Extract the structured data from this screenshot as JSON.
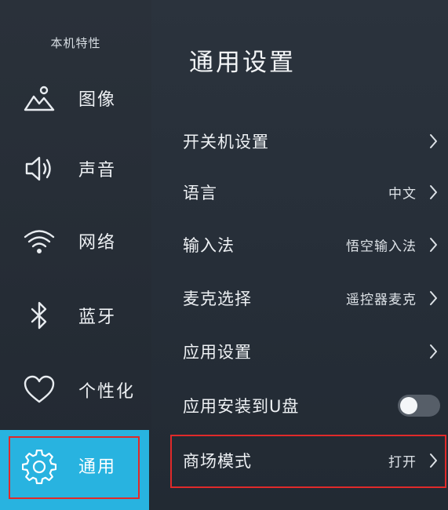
{
  "sidebar": {
    "title": "本机特性",
    "items": [
      {
        "label": "图像",
        "icon": "picture-icon"
      },
      {
        "label": "声音",
        "icon": "speaker-icon"
      },
      {
        "label": "网络",
        "icon": "wifi-icon"
      },
      {
        "label": "蓝牙",
        "icon": "bluetooth-icon"
      },
      {
        "label": "个性化",
        "icon": "heart-icon"
      },
      {
        "label": "通用",
        "icon": "gear-icon",
        "active": true
      }
    ]
  },
  "main": {
    "title": "通用设置",
    "rows": [
      {
        "label": "开关机设置",
        "value": "",
        "control": "chevron"
      },
      {
        "label": "语言",
        "value": "中文",
        "control": "chevron"
      },
      {
        "label": "输入法",
        "value": "悟空输入法",
        "control": "chevron"
      },
      {
        "label": "麦克选择",
        "value": "遥控器麦克",
        "control": "chevron"
      },
      {
        "label": "应用设置",
        "value": "",
        "control": "chevron"
      },
      {
        "label": "应用安装到U盘",
        "value": "",
        "control": "toggle",
        "toggle_on": false
      },
      {
        "label": "商场模式",
        "value": "打开",
        "control": "chevron"
      }
    ]
  },
  "colors": {
    "accent": "#28b3e0",
    "highlight_border": "#e02a2a",
    "background": "#262e38"
  }
}
